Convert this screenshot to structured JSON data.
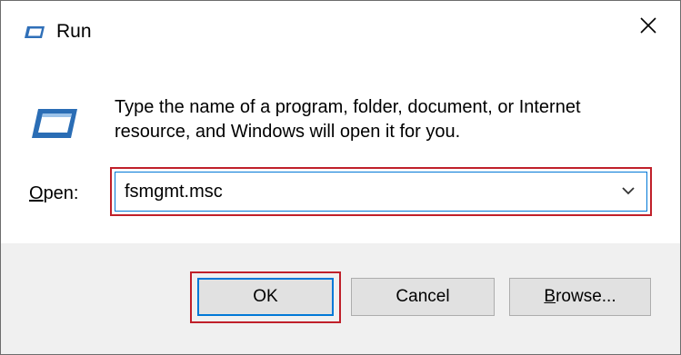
{
  "window": {
    "title": "Run",
    "title_icon": "run-icon",
    "close_icon": "close-icon"
  },
  "dialog": {
    "icon": "run-icon",
    "description": "Type the name of a program, folder, document, or Internet resource, and Windows will open it for you.",
    "open_label_mnemonic": "O",
    "open_label_rest": "pen:",
    "open_value": "fsmgmt.msc",
    "dropdown_icon": "chevron-down-icon"
  },
  "buttons": {
    "ok_label": "OK",
    "cancel_label": "Cancel",
    "browse_mnemonic": "B",
    "browse_rest": "rowse..."
  },
  "colors": {
    "highlight": "#c0202a",
    "focus": "#0078d7",
    "button_face": "#e1e1e1",
    "footer_bg": "#f0f0f0"
  }
}
